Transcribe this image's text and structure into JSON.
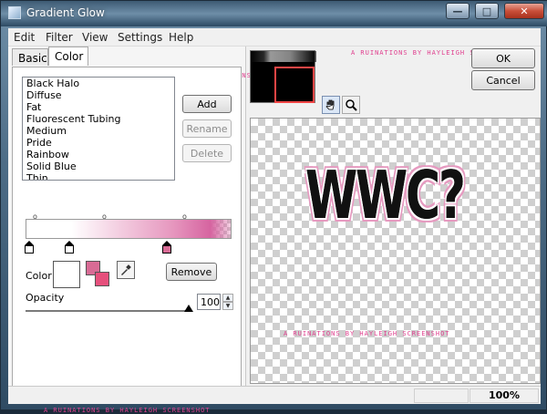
{
  "window": {
    "title": "Gradient Glow",
    "caption": {
      "minimize": "—",
      "maximize": "□",
      "close": "✕"
    }
  },
  "menu": [
    "Edit",
    "Filter",
    "View",
    "Settings",
    "Help"
  ],
  "tabs": [
    {
      "label": "Basic",
      "selected": false
    },
    {
      "label": "Color",
      "selected": true
    }
  ],
  "watermark": "a ruinations by hayleigh screenshot",
  "presets": {
    "items": [
      "Black Halo",
      "Diffuse",
      "Fat",
      "Fluorescent Tubing",
      "Medium",
      "Pride",
      "Rainbow",
      "Solid Blue",
      "Thin"
    ]
  },
  "buttons": {
    "add": "Add",
    "rename": "Rename",
    "delete": "Delete",
    "remove": "Remove",
    "ok": "OK",
    "cancel": "Cancel"
  },
  "gradient": {
    "colors": {
      "white": "#ffffff",
      "pink": "#d86b95",
      "pink_light": "#e69ac0",
      "pink_deep": "#e6507c"
    }
  },
  "color_section": {
    "label": "Color",
    "swatch_primary": "#ffffff",
    "swatch_secondary": "#d86b95"
  },
  "opacity": {
    "label": "Opacity",
    "value": "100"
  },
  "preview": {
    "text": "WWC?",
    "glow_color": "#e69ac0",
    "thumb_rect_color": "#f04545"
  },
  "tools": {
    "hand": "hand-icon",
    "zoom": "magnifier-icon"
  },
  "status": {
    "zoom": "100%"
  }
}
